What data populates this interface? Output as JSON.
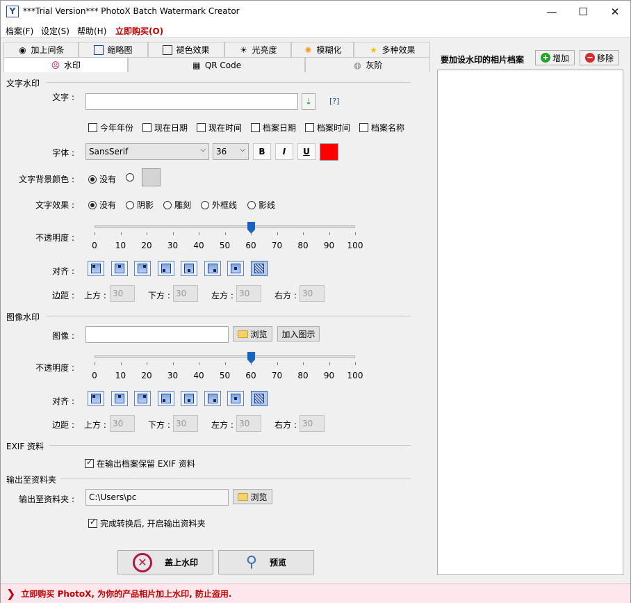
{
  "window": {
    "title": "***Trial Version*** PhotoX Batch Watermark Creator",
    "app_icon": "Y",
    "minimize": "—",
    "maximize": "☐",
    "close": "✕"
  },
  "menu": {
    "file": "档案(F)",
    "settings": "设定(S)",
    "help": "帮助(H)",
    "buy": "立即购买(O)"
  },
  "tabs_row1": [
    {
      "label": "加上间条",
      "icon": "stripe-icon"
    },
    {
      "label": "缩略图",
      "icon": "thumbnail-icon"
    },
    {
      "label": "褪色效果",
      "icon": "fade-icon"
    },
    {
      "label": "光亮度",
      "icon": "brightness-icon"
    },
    {
      "label": "模糊化",
      "icon": "blur-icon"
    },
    {
      "label": "多种效果",
      "icon": "star-icon"
    }
  ],
  "tabs_row2": [
    {
      "label": "水印",
      "icon": "watermark-icon"
    },
    {
      "label": "QR Code",
      "icon": "qr-icon"
    },
    {
      "label": "灰阶",
      "icon": "grayscale-icon"
    }
  ],
  "text_watermark": {
    "section": "文字水印",
    "text_label": "文字 :",
    "text_value": "",
    "help": "[?]",
    "checkboxes": [
      "今年年份",
      "现在日期",
      "现在时间",
      "档案日期",
      "档案时间",
      "档案名称"
    ],
    "font_label": "字体 :",
    "font_value": "SansSerif",
    "size_value": "36",
    "bold": "B",
    "italic": "I",
    "underline": "U",
    "font_color": "#ff0000",
    "bg_label": "文字背景颜色 :",
    "bg_none": "没有",
    "bg_color": "#d4d4d4",
    "effect_label": "文字效果 :",
    "effects": [
      "没有",
      "阴影",
      "雕刻",
      "外框线",
      "影线"
    ],
    "opacity_label": "不透明度 :",
    "opacity": 60,
    "ticks": [
      "0",
      "10",
      "20",
      "30",
      "40",
      "50",
      "60",
      "70",
      "80",
      "90",
      "100"
    ],
    "align_label": "对齐 :",
    "margin_label": "边距 :",
    "margins": [
      {
        "label": "上方 :",
        "value": "30"
      },
      {
        "label": "下方 :",
        "value": "30"
      },
      {
        "label": "左方 :",
        "value": "30"
      },
      {
        "label": "右方 :",
        "value": "30"
      }
    ]
  },
  "image_watermark": {
    "section": "图像水印",
    "image_label": "图像 :",
    "image_value": "",
    "browse": "浏览",
    "add_icon": "加入图示",
    "opacity_label": "不透明度 :",
    "opacity": 60,
    "align_label": "对齐 :",
    "margin_label": "边距 :",
    "margins": [
      {
        "label": "上方 :",
        "value": "30"
      },
      {
        "label": "下方 :",
        "value": "30"
      },
      {
        "label": "左方 :",
        "value": "30"
      },
      {
        "label": "右方 :",
        "value": "30"
      }
    ]
  },
  "exif": {
    "section": "EXIF 资料",
    "keep": "在输出档案保留 EXIF 资料"
  },
  "output": {
    "section": "输出至资料夹",
    "label": "输出至资料夹 :",
    "path": "C:\\Users\\pc",
    "browse": "浏览",
    "open_after": "完成转换后, 开启输出资料夹"
  },
  "actions": {
    "apply": "盖上水印",
    "preview": "预览"
  },
  "right": {
    "title": "要加设水印的相片档案",
    "add": "增加",
    "remove": "移除"
  },
  "footer": {
    "text": "立即购买 PhotoX, 为你的产品相片加上水印, 防止盗用."
  }
}
